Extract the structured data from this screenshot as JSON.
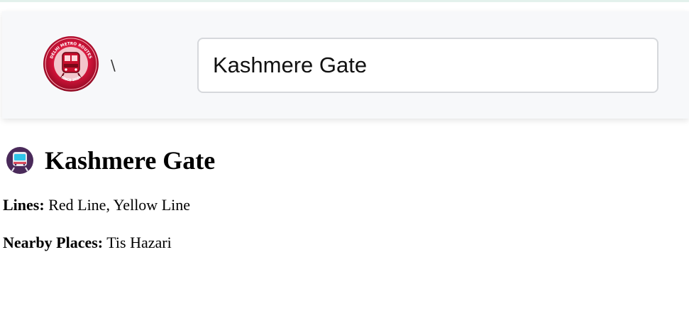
{
  "header": {
    "logo_text_top": "DELHI METRO ROUTES",
    "logo_text_bottom": "SINCE 2024",
    "separator": "\\",
    "search": {
      "value": "Kashmere Gate",
      "placeholder": ""
    }
  },
  "station": {
    "icon": "metro-train-icon",
    "name": "Kashmere Gate",
    "lines_label": "Lines:",
    "lines_value": "Red Line, Yellow Line",
    "nearby_label": "Nearby Places:",
    "nearby_value": "Tis Hazari"
  },
  "colors": {
    "logo_red": "#c8102e",
    "header_bg": "#f7f8fa",
    "icon_purple": "#4a2a5a",
    "icon_cyan": "#2ec5e8"
  }
}
